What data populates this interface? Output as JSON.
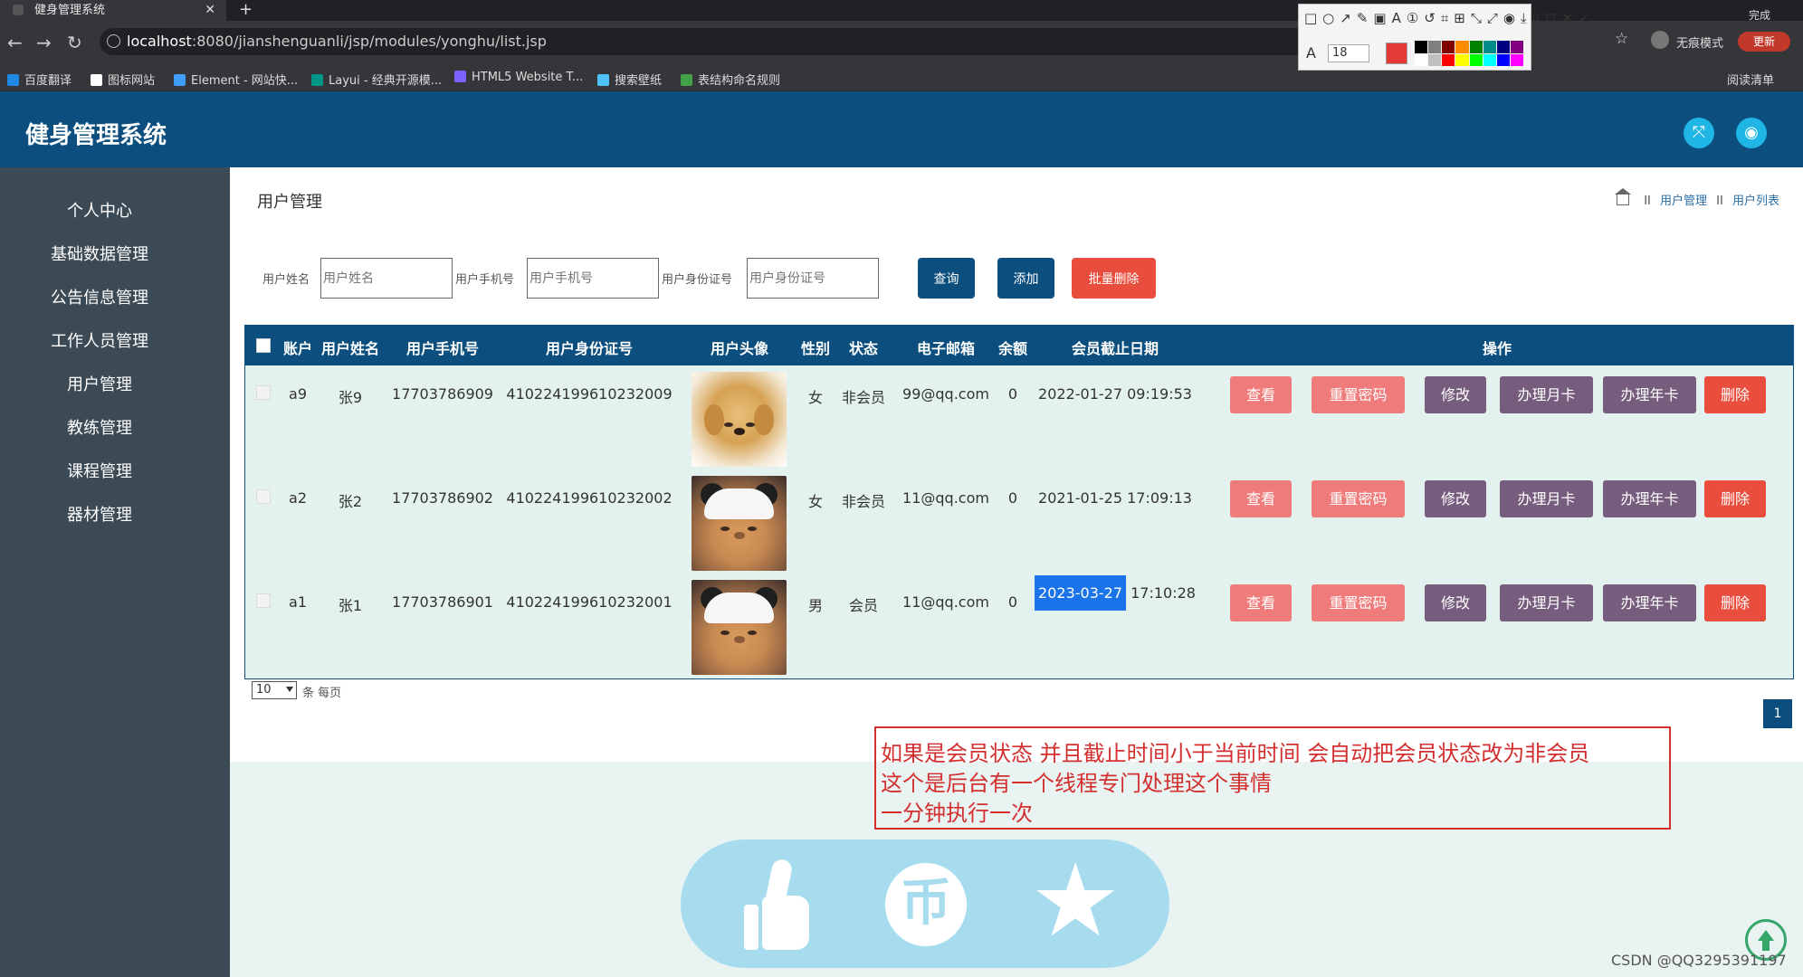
{
  "browser": {
    "tab_title": "健身管理系统",
    "tab_close": "✕",
    "new_tab": "+",
    "url_host": "localhost",
    "url_rest": ":8080/jianshenguanli/jsp/modules/yonghu/list.jsp",
    "bookmarks": [
      {
        "label": "百度翻译",
        "color": "#1e88e5"
      },
      {
        "label": "图标网站",
        "color": "#ffffff"
      },
      {
        "label": "Element - 网站快...",
        "color": "#409eff"
      },
      {
        "label": "Layui - 经典开源模...",
        "color": "#009688"
      },
      {
        "label": "HTML5 Website T...",
        "color": "#7b61ff"
      },
      {
        "label": "搜索壁纸",
        "color": "#4fc3f7"
      },
      {
        "label": "表结构命名规则",
        "color": "#43a047"
      }
    ],
    "incognito_label": "无痕模式",
    "update_label": "更新",
    "reading_list": "阅读清单",
    "annot_font_size": "18",
    "annot_row_text": "□○↗✎▣A①↺⌗⊞⤡⤢◉⤓▯⊡✕✓",
    "annot_done": "完成",
    "palette": [
      "#000000",
      "#808080",
      "#800000",
      "#ff8c00",
      "#008000",
      "#008b8b",
      "#000080",
      "#800080",
      "#ffffff",
      "#c0c0c0",
      "#ff0000",
      "#ffff00",
      "#00ff00",
      "#00ffff",
      "#0000ff",
      "#ff00ff"
    ]
  },
  "app": {
    "title": "健身管理系统"
  },
  "sidebar": {
    "items": [
      {
        "label": "个人中心"
      },
      {
        "label": "基础数据管理"
      },
      {
        "label": "公告信息管理"
      },
      {
        "label": "工作人员管理"
      },
      {
        "label": "用户管理"
      },
      {
        "label": "教练管理"
      },
      {
        "label": "课程管理"
      },
      {
        "label": "器材管理"
      }
    ]
  },
  "page": {
    "title": "用户管理",
    "breadcrumb": [
      "用户管理",
      "用户列表"
    ],
    "breadcrumb_sep": "II"
  },
  "search": {
    "name_label": "用户姓名",
    "name_placeholder": "用户姓名",
    "phone_label": "用户手机号",
    "phone_placeholder": "用户手机号",
    "idcard_label": "用户身份证号",
    "idcard_placeholder": "用户身份证号",
    "query_label": "查询",
    "add_label": "添加",
    "batch_delete_label": "批量删除"
  },
  "table": {
    "headers": [
      "账户",
      "用户姓名",
      "用户手机号",
      "用户身份证号",
      "用户头像",
      "性别",
      "状态",
      "电子邮箱",
      "余额",
      "会员截止日期",
      "操作"
    ],
    "actions": [
      "查看",
      "重置密码",
      "修改",
      "办理月卡",
      "办理年卡",
      "删除"
    ],
    "rows": [
      {
        "account": "a9",
        "name": "张9",
        "phone": "17703786909",
        "idcard": "410224199610232009",
        "avatar": "puppy",
        "gender": "女",
        "status": "非会员",
        "email": "99@qq.com",
        "balance": "0",
        "date": "2022-01-27",
        "time": "09:19:53"
      },
      {
        "account": "a2",
        "name": "张2",
        "phone": "17703786902",
        "idcard": "410224199610232002",
        "avatar": "cat",
        "gender": "女",
        "status": "非会员",
        "email": "11@qq.com",
        "balance": "0",
        "date": "2021-01-25",
        "time": "17:09:13"
      },
      {
        "account": "a1",
        "name": "张1",
        "phone": "17703786901",
        "idcard": "410224199610232001",
        "avatar": "cat",
        "gender": "男",
        "status": "会员",
        "email": "11@qq.com",
        "balance": "0",
        "date": "2023-03-27",
        "time": "17:10:28"
      }
    ]
  },
  "pagination": {
    "page_size": "10",
    "per_page_label": "条 每页",
    "current_page": "1"
  },
  "annotation": {
    "lines": [
      "如果是会员状态 并且截止时间小于当前时间 会自动把会员状态改为非会员",
      "这个是后台有一个线程专门处理这个事情",
      "一分钟执行一次"
    ],
    "color": "#d32f2f"
  },
  "support": {
    "coin_glyph": "币"
  },
  "watermark": "CSDN @QQ3295391197"
}
